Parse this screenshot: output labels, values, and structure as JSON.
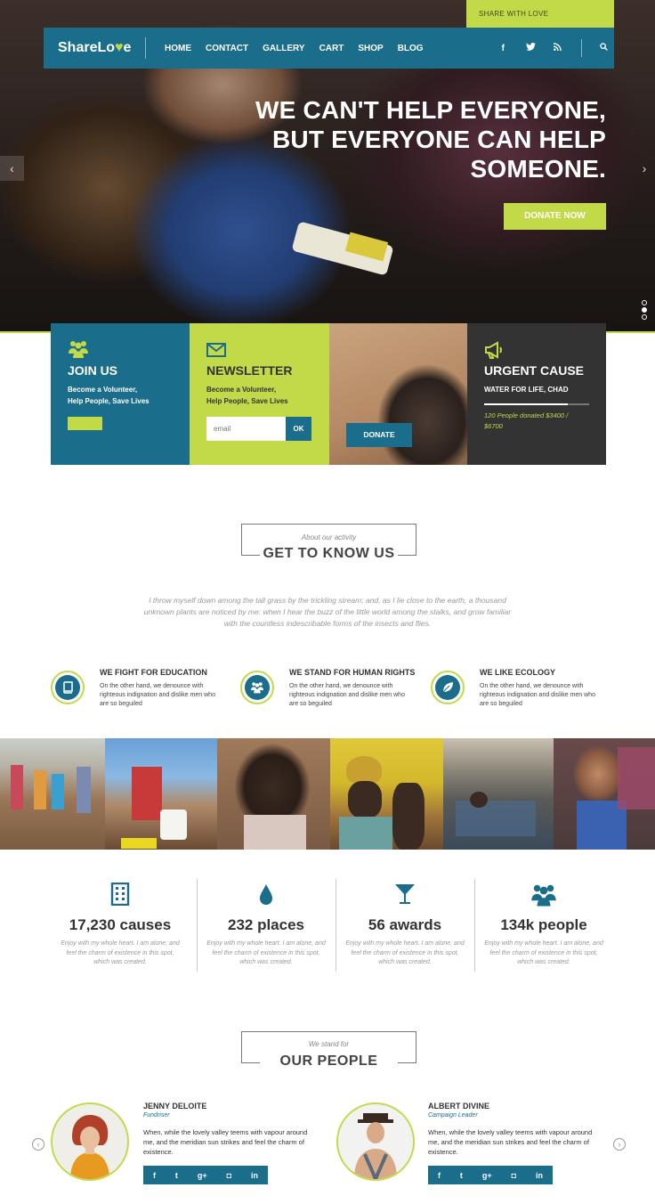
{
  "topbar": {
    "text": "SHARE WITH LOVE"
  },
  "brand": {
    "prefix": "ShareLo",
    "heart": "♥",
    "suffix": "e"
  },
  "nav": [
    "HOME",
    "CONTACT",
    "GALLERY",
    "CART",
    "SHOP",
    "BLOG"
  ],
  "social_top": {
    "facebook": "f",
    "twitter": "t",
    "rss": "◉",
    "search": "⚲"
  },
  "hero": {
    "line1": "WE CAN'T HELP EVERYONE,",
    "line2": "BUT EVERYONE CAN HELP",
    "line3": "SOMEONE.",
    "cta": "DONATE NOW"
  },
  "cards": {
    "join": {
      "title": "JOIN US",
      "line1": "Become a Volunteer,",
      "line2": "Help People, Save Lives"
    },
    "newsletter": {
      "title": "NEWSLETTER",
      "line1": "Become a Volunteer,",
      "line2": "Help People, Save Lives",
      "placeholder": "email",
      "button": "OK"
    },
    "photo": {
      "button": "DONATE"
    },
    "urgent": {
      "title": "URGENT CAUSE",
      "subtitle": "WATER FOR LIFE, CHAD",
      "progress": 0.8,
      "status_line1": "120 People donated $3400 /",
      "status_line2": "$6700"
    }
  },
  "about": {
    "sub": "About our activity",
    "title": "GET TO KNOW US",
    "quote_l1": "I throw myself down among the tall grass by the trickling stream; and, as I lie close to the earth, a thousand",
    "quote_l2": "unknown plants are noticed by me: when I hear the buzz of the little world among the stalks, and grow familiar",
    "quote_l3": "with the countless indescribable forms of the insects and flies."
  },
  "features": [
    {
      "title": "WE FIGHT FOR EDUCATION",
      "l1": "On the other hand, we denounce with",
      "l2": "righteous indignation and dislike men who",
      "l3": "are so beguiled",
      "icon": "book-icon"
    },
    {
      "title": "WE STAND FOR HUMAN RIGHTS",
      "l1": "On the other hand, we denounce with",
      "l2": "righteous indignation and dislike men who",
      "l3": "are so beguiled",
      "icon": "people-icon"
    },
    {
      "title": "WE LIKE ECOLOGY",
      "l1": "On the other hand, we denounce with",
      "l2": "righteous indignation and dislike men who",
      "l3": "are so beguiled",
      "icon": "leaf-icon"
    }
  ],
  "stats": [
    {
      "num": "17,230 causes",
      "icon": "building-icon"
    },
    {
      "num": "232 places",
      "icon": "drop-icon"
    },
    {
      "num": "56 awards",
      "icon": "glass-icon"
    },
    {
      "num": "134k people",
      "icon": "people-icon"
    }
  ],
  "stat_text": {
    "l1": "Enjoy with my whole heart. I am alone, and",
    "l2": "feel the charm of existence in this spot,",
    "l3": "which was created."
  },
  "people_section": {
    "sub": "We stand for",
    "title": "OUR PEOPLE"
  },
  "people": [
    {
      "name": "JENNY DELOITE",
      "role": "Fundriser",
      "l1": "When, while the lovely valley teems with vapour around",
      "l2": "me, and the meridian sun strikes and feel the charm of",
      "l3": "existence."
    },
    {
      "name": "ALBERT DIVINE",
      "role": "Campaign Leader",
      "l1": "When, while the lovely valley teems with vapour around",
      "l2": "me, and the meridian sun strikes and feel the charm of",
      "l3": "existence."
    }
  ],
  "people_social": [
    "f",
    "t",
    "g+",
    "◘",
    "in"
  ],
  "colors": {
    "primary": "#1a6e8c",
    "accent": "#c2d948",
    "dark": "#333333"
  }
}
